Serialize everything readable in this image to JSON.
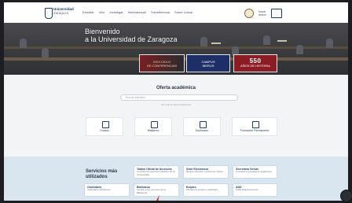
{
  "nav": {
    "logo_name": "Universidad",
    "logo_sub": "Zaragoza",
    "links": [
      "Estudiar",
      "Vivir",
      "Investigar",
      "Internacional",
      "Transferencia",
      "Sobre Unizar"
    ],
    "login_line1": "Iniciar",
    "login_line2": "sesión"
  },
  "hero": {
    "title_line1": "Bienvenido",
    "title_line2": "a la Universidad de Zaragoza"
  },
  "banners": [
    {
      "line1": "XXVI CICLO",
      "line2": "DE CONFERENCIAS"
    },
    {
      "line1": "CAMPUS",
      "line2": "IBERUS"
    },
    {
      "line1": "550",
      "line2": "AÑOS DE HISTORIA"
    }
  ],
  "oferta": {
    "title": "Oferta académica",
    "search_placeholder": "Buscar estudios",
    "note": "Ver toda la oferta académica",
    "cards": [
      {
        "label": "Grados",
        "icon": "graduation-icon"
      },
      {
        "label": "Másteres",
        "icon": "book-icon"
      },
      {
        "label": "Doctorado",
        "icon": "doctorate-icon"
      },
      {
        "label": "Formación Permanente",
        "icon": "certificate-icon"
      }
    ]
  },
  "services": {
    "title_line1": "Servicios más",
    "title_line2": "utilizados",
    "items": [
      {
        "title": "Tablón Oficial de Anuncios",
        "desc": "Consulta los anuncios oficiales de la Universidad"
      },
      {
        "title": "Sede Electrónica",
        "desc": "Realiza trámites y gestiones online"
      },
      {
        "title": "Secretaría Virtual",
        "desc": "Consulta tu expediente académico"
      },
      {
        "title": "Calendario",
        "desc": "Calendario académico"
      },
      {
        "title": "Biblioteca",
        "desc": "Accede a los recursos de la Biblioteca"
      },
      {
        "title": "Empleo",
        "desc": "Ofertas de empleo y prácticas"
      },
      {
        "title": "ADD",
        "desc": "Anillo Digital Docente"
      }
    ]
  },
  "colors": {
    "brand_blue": "#1d3f6e",
    "services_bg": "#d9e6ef",
    "banner_red": "#8c1c24"
  }
}
